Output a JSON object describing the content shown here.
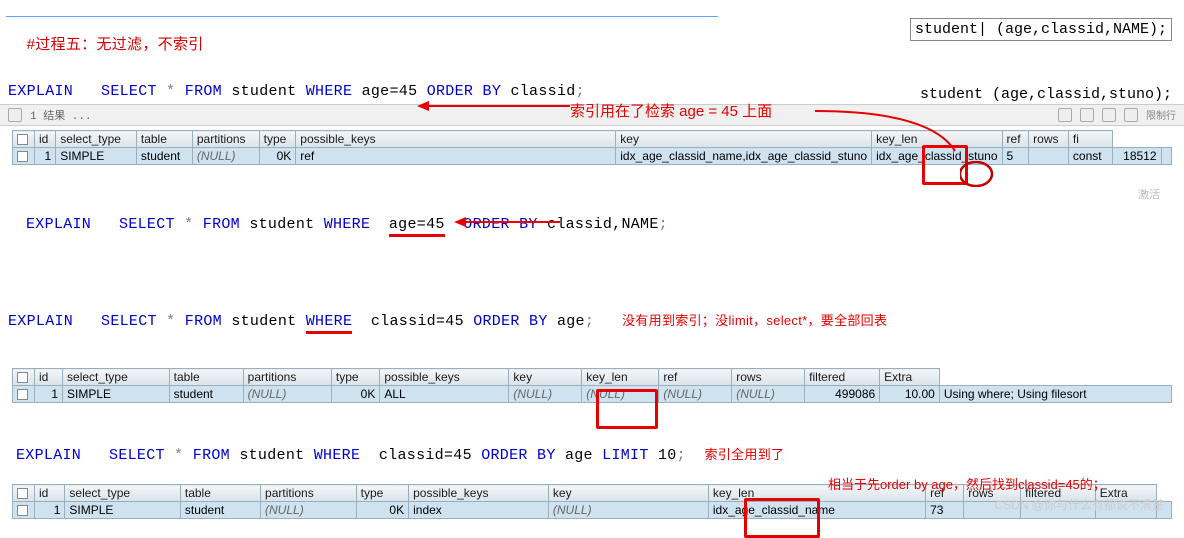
{
  "side_label1": "student| (age,classid,NAME);",
  "side_label2": "student (age,classid,stuno);",
  "comment_title": "#过程五：无过滤，不索引",
  "sql1": {
    "explain": "EXPLAIN",
    "select": "SELECT",
    "star": "*",
    "from": "FROM",
    "tbl": "student",
    "where": "WHERE",
    "cond": "age=45",
    "orderby": "ORDER BY",
    "col": "classid",
    "semi": ";"
  },
  "anno1": "索引用在了检索 age = 45 上面",
  "toolbar_text": "1 结果 ...",
  "t1": {
    "headers": [
      "",
      "id",
      "select_type",
      "table",
      "partitions",
      "type",
      "possible_keys",
      "key",
      "key_len",
      "ref",
      "rows",
      "fi"
    ],
    "row": [
      "",
      "1",
      "SIMPLE",
      "student",
      "(NULL)",
      "0K",
      "ref",
      "idx_age_classid_name,idx_age_classid_stuno",
      "idx_age_classid_stuno",
      "5",
      "",
      "const",
      "18512",
      ""
    ]
  },
  "sql2": {
    "explain": "EXPLAIN",
    "select": "SELECT",
    "star": "*",
    "from": "FROM",
    "tbl": "student",
    "where": "WHERE",
    "cond": "age=45",
    "orderby": "ORDER BY",
    "cols": "classid,NAME",
    "semi": ";"
  },
  "sql3": {
    "explain": "EXPLAIN",
    "select": "SELECT",
    "star": "*",
    "from": "FROM",
    "tbl": "student",
    "where": "WHERE",
    "cond": "classid=45",
    "orderby": "ORDER BY",
    "col": "age",
    "semi": ";"
  },
  "anno3": "没有用到索引；没limit，select*，要全部回表",
  "t2": {
    "headers": [
      "",
      "id",
      "select_type",
      "table",
      "partitions",
      "type",
      "possible_keys",
      "key",
      "key_len",
      "ref",
      "rows",
      "filtered",
      "Extra"
    ],
    "row": [
      "",
      "1",
      "SIMPLE",
      "student",
      "(NULL)",
      "0K",
      "ALL",
      "(NULL)",
      "(NULL)",
      "(NULL)",
      "(NULL)",
      "499086",
      "10.00",
      "Using where; Using filesort"
    ]
  },
  "sql4": {
    "explain": "EXPLAIN",
    "select": "SELECT",
    "star": "*",
    "from": "FROM",
    "tbl": "student",
    "where": "WHERE",
    "cond": "classid=45",
    "orderby": "ORDER BY",
    "col": "age",
    "limit": "LIMIT",
    "limval": "10",
    "semi": ";"
  },
  "anno4a": "索引全用到了",
  "anno4b": "相当于先order by age，然后找到classid=45的；",
  "t3": {
    "headers": [
      "",
      "id",
      "select_type",
      "table",
      "partitions",
      "type",
      "possible_keys",
      "key",
      "key_len",
      "ref",
      "rows",
      "filtered",
      "Extra"
    ],
    "row": [
      "",
      "1",
      "SIMPLE",
      "student",
      "(NULL)",
      "0K",
      "index",
      "(NULL)",
      "idx_age_classid_name",
      "73",
      "",
      "",
      "",
      ""
    ]
  },
  "activate": "激活",
  "watermark": "CSDN @你与什么有都说不清楚"
}
